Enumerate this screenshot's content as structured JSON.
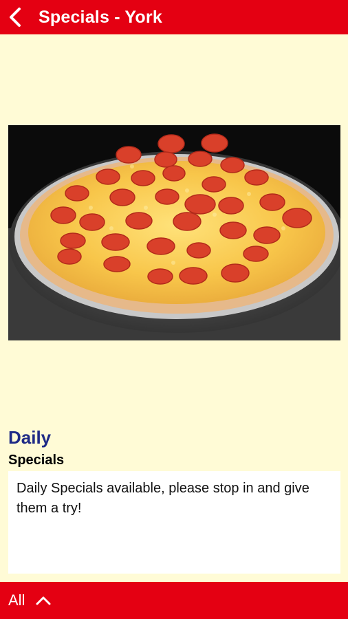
{
  "header": {
    "title": "Specials - York",
    "back_icon": "chevron-left-icon"
  },
  "main": {
    "image": "pepperoni-pizza-photo",
    "heading": "Daily",
    "subheading": "Specials",
    "description": "Daily Specials available, please stop in and give them a try!"
  },
  "footer": {
    "filter_label": "All",
    "expand_icon": "chevron-up-icon"
  },
  "colors": {
    "brand_red": "#e40012",
    "background": "#fffbd6",
    "heading_blue": "#1e2a86"
  }
}
